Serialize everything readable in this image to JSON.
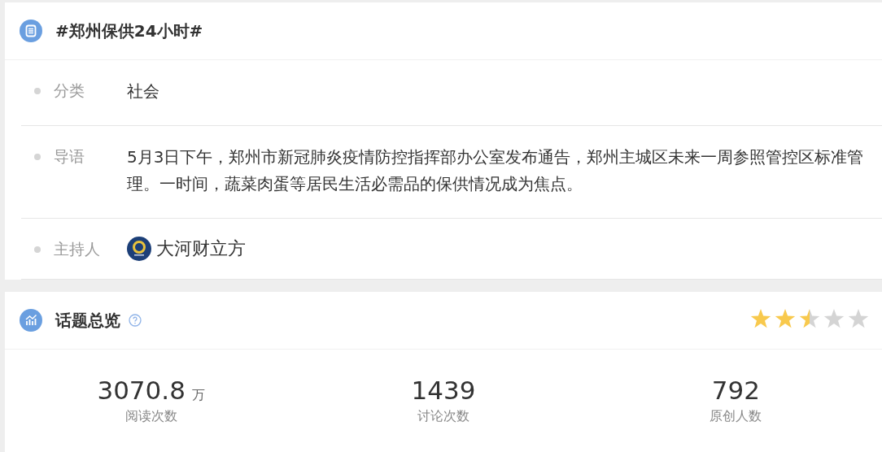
{
  "topic": {
    "title": "#郑州保供24小时#",
    "fields": [
      {
        "label": "分类",
        "value": "社会",
        "kind": "text"
      },
      {
        "label": "导语",
        "value": "5月3日下午，郑州市新冠肺炎疫情防控指挥部办公室发布通告，郑州主城区未来一周参照管控区标准管理。一时间，蔬菜肉蛋等居民生活必需品的保供情况成为焦点。",
        "kind": "text"
      },
      {
        "label": "主持人",
        "value": "大河财立方",
        "kind": "host"
      }
    ]
  },
  "overview": {
    "title": "话题总览",
    "stars": 2.5,
    "stats": [
      {
        "value": "3070.8",
        "unit": "万",
        "label": "阅读次数"
      },
      {
        "value": "1439",
        "label": "讨论次数"
      },
      {
        "value": "792",
        "label": "原创人数"
      }
    ]
  }
}
